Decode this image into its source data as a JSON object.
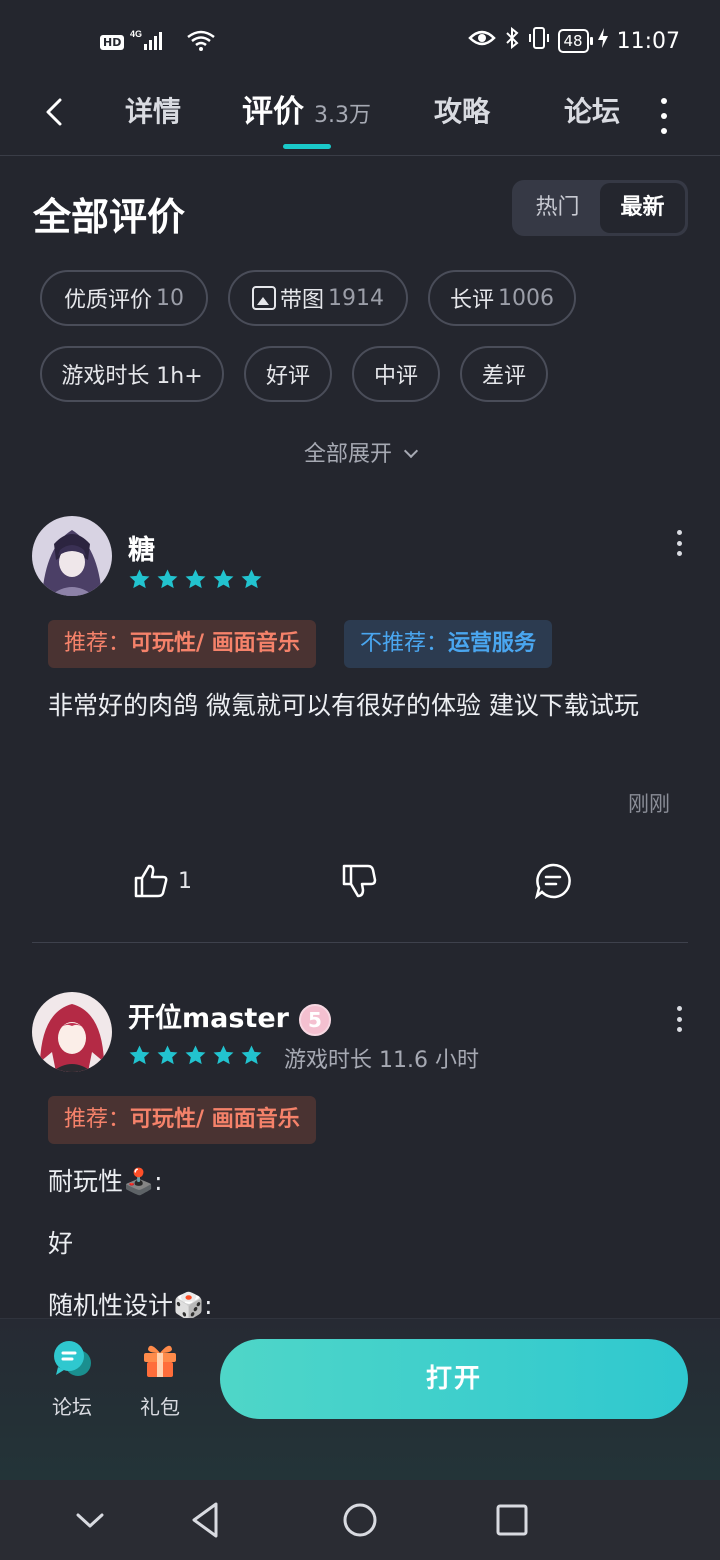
{
  "status_bar": {
    "hd": "HD",
    "network": "4G",
    "battery": "48",
    "time": "11:07"
  },
  "nav": {
    "tabs": [
      {
        "label": "详情"
      },
      {
        "label": "评价",
        "count": "3.3万"
      },
      {
        "label": "攻略"
      },
      {
        "label": "论坛"
      }
    ]
  },
  "section": {
    "title": "全部评价",
    "sort": [
      "热门",
      "最新"
    ],
    "active_sort": "最新"
  },
  "filters": [
    {
      "label": "优质评价",
      "count": "10"
    },
    {
      "label": "带图",
      "count": "1914"
    },
    {
      "label": "长评",
      "count": "1006"
    },
    {
      "label": "游戏时长 1h+"
    },
    {
      "label": "好评"
    },
    {
      "label": "中评"
    },
    {
      "label": "差评"
    }
  ],
  "expand_all": "全部展开",
  "reviews": [
    {
      "user": "糖",
      "stars": 5,
      "tags": {
        "recommend_label": "推荐：",
        "recommend": "可玩性/ 画面音乐",
        "not_recommend_label": "不推荐：",
        "not_recommend": "运营服务"
      },
      "text": "非常好的肉鸽 微氪就可以有很好的体验 建议下载试玩",
      "time": "刚刚",
      "likes": "1"
    },
    {
      "user": "开位master",
      "badge": "5",
      "stars": 5,
      "playtime": "游戏时长 11.6 小时",
      "tags": {
        "recommend_label": "推荐：",
        "recommend": "可玩性/ 画面音乐"
      },
      "lines": [
        "耐玩性🕹️:",
        "好",
        "随机性设计🎲:"
      ]
    }
  ],
  "bottom_bar": {
    "forum": "论坛",
    "gift": "礼包",
    "open": "打开"
  },
  "colors": {
    "background": "#24262e",
    "accent": "#1ac9c9",
    "star": "#22c3cf",
    "positive": "#f5826a",
    "negative": "#4aa6ef"
  }
}
